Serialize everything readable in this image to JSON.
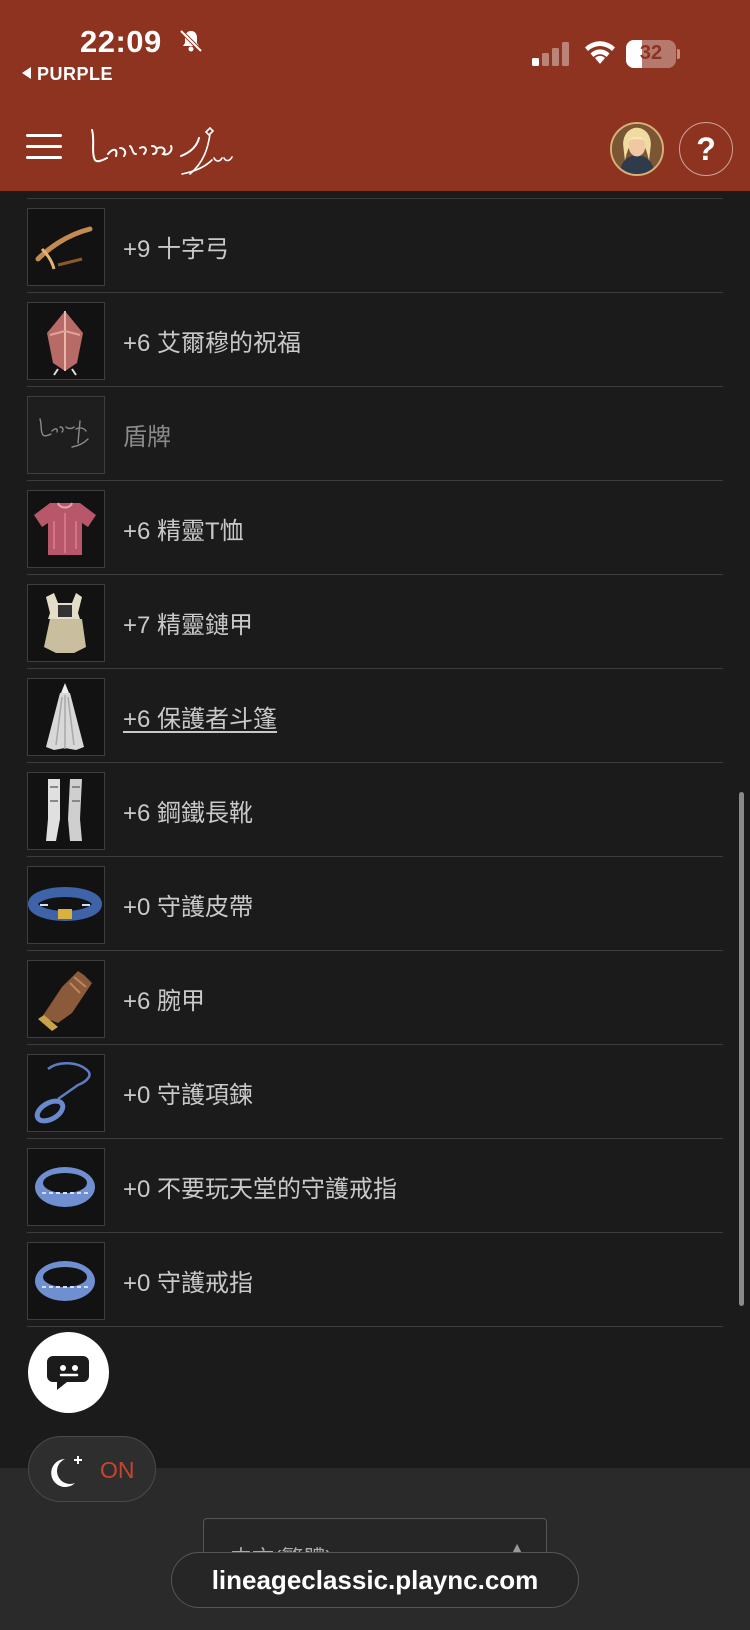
{
  "status_bar": {
    "time": "22:09",
    "back_app": "PURPLE",
    "battery_percent": 32,
    "battery_label": "32"
  },
  "header": {
    "logo_text": "Lineage Classic",
    "help_label": "?"
  },
  "equipment": [
    {
      "name": "+9 十字弓",
      "icon": "crossbow-icon"
    },
    {
      "name": "+6 艾爾穆的祝福",
      "icon": "shield-blessing-icon"
    },
    {
      "name": "盾牌",
      "icon": "empty-slot-logo-icon"
    },
    {
      "name": "+6 精靈T恤",
      "icon": "tshirt-icon"
    },
    {
      "name": "+7 精靈鏈甲",
      "icon": "chainmail-icon"
    },
    {
      "name": "+6 保護者斗篷",
      "icon": "cloak-icon"
    },
    {
      "name": "+6 鋼鐵長靴",
      "icon": "boots-icon"
    },
    {
      "name": "+0 守護皮帶",
      "icon": "belt-icon"
    },
    {
      "name": "+6 腕甲",
      "icon": "gauntlet-icon"
    },
    {
      "name": "+0 守護項鍊",
      "icon": "necklace-icon"
    },
    {
      "name": "+0 不要玩天堂的守護戒指",
      "icon": "ring-icon"
    },
    {
      "name": "+0 守護戒指",
      "icon": "ring-icon"
    }
  ],
  "floating": {
    "chatbot_icon": "chatbot-icon",
    "dark_mode_label": "ON"
  },
  "footer": {
    "language_value": "中文(繁體)",
    "url": "lineageclassic.plaync.com"
  },
  "colors": {
    "header_bg": "#8e3320",
    "page_bg": "#1b1b1b",
    "accent_red": "#c8442e"
  }
}
